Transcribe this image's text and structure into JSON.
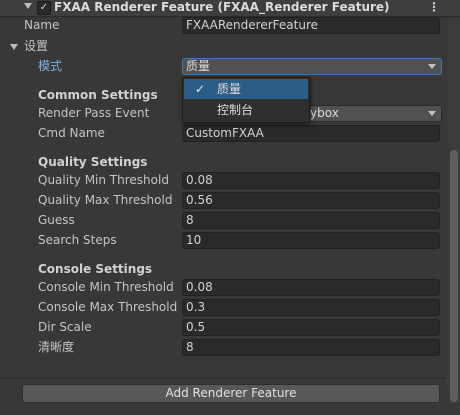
{
  "header": {
    "title": "FXAA Renderer Feature (FXAA_Renderer Feature)",
    "enabled_check": "✓",
    "menu_icon": "⋮"
  },
  "name_row": {
    "label": "Name",
    "value": "FXAARendererFeature"
  },
  "settings": {
    "label": "设置",
    "mode": {
      "label": "模式",
      "value": "质量"
    }
  },
  "common": {
    "title": "Common Settings",
    "render_pass_event": {
      "label": "Render Pass Event",
      "value_visible": "ybox"
    },
    "cmd_name": {
      "label": "Cmd Name",
      "value": "CustomFXAA"
    }
  },
  "quality": {
    "title": "Quality Settings",
    "rows": [
      {
        "label": "Quality Min Threshold",
        "value": "0.08"
      },
      {
        "label": "Quality Max Threshold",
        "value": "0.56"
      },
      {
        "label": "Guess",
        "value": "8"
      },
      {
        "label": "Search Steps",
        "value": "10"
      }
    ]
  },
  "console": {
    "title": "Console Settings",
    "rows": [
      {
        "label": "Console Min Threshold",
        "value": "0.08"
      },
      {
        "label": "Console Max Threshold",
        "value": "0.3"
      },
      {
        "label": "Dir Scale",
        "value": "0.5"
      },
      {
        "label": "清晰度",
        "value": "8"
      }
    ]
  },
  "mode_popup": {
    "items": [
      {
        "label": "质量",
        "selected": true
      },
      {
        "label": "控制台",
        "selected": false
      }
    ],
    "check": "✓"
  },
  "add_button": {
    "label": "Add Renderer Feature"
  },
  "colors": {
    "accent": "#2c5d87",
    "focus_border": "#3a79bb",
    "background": "#383838"
  }
}
